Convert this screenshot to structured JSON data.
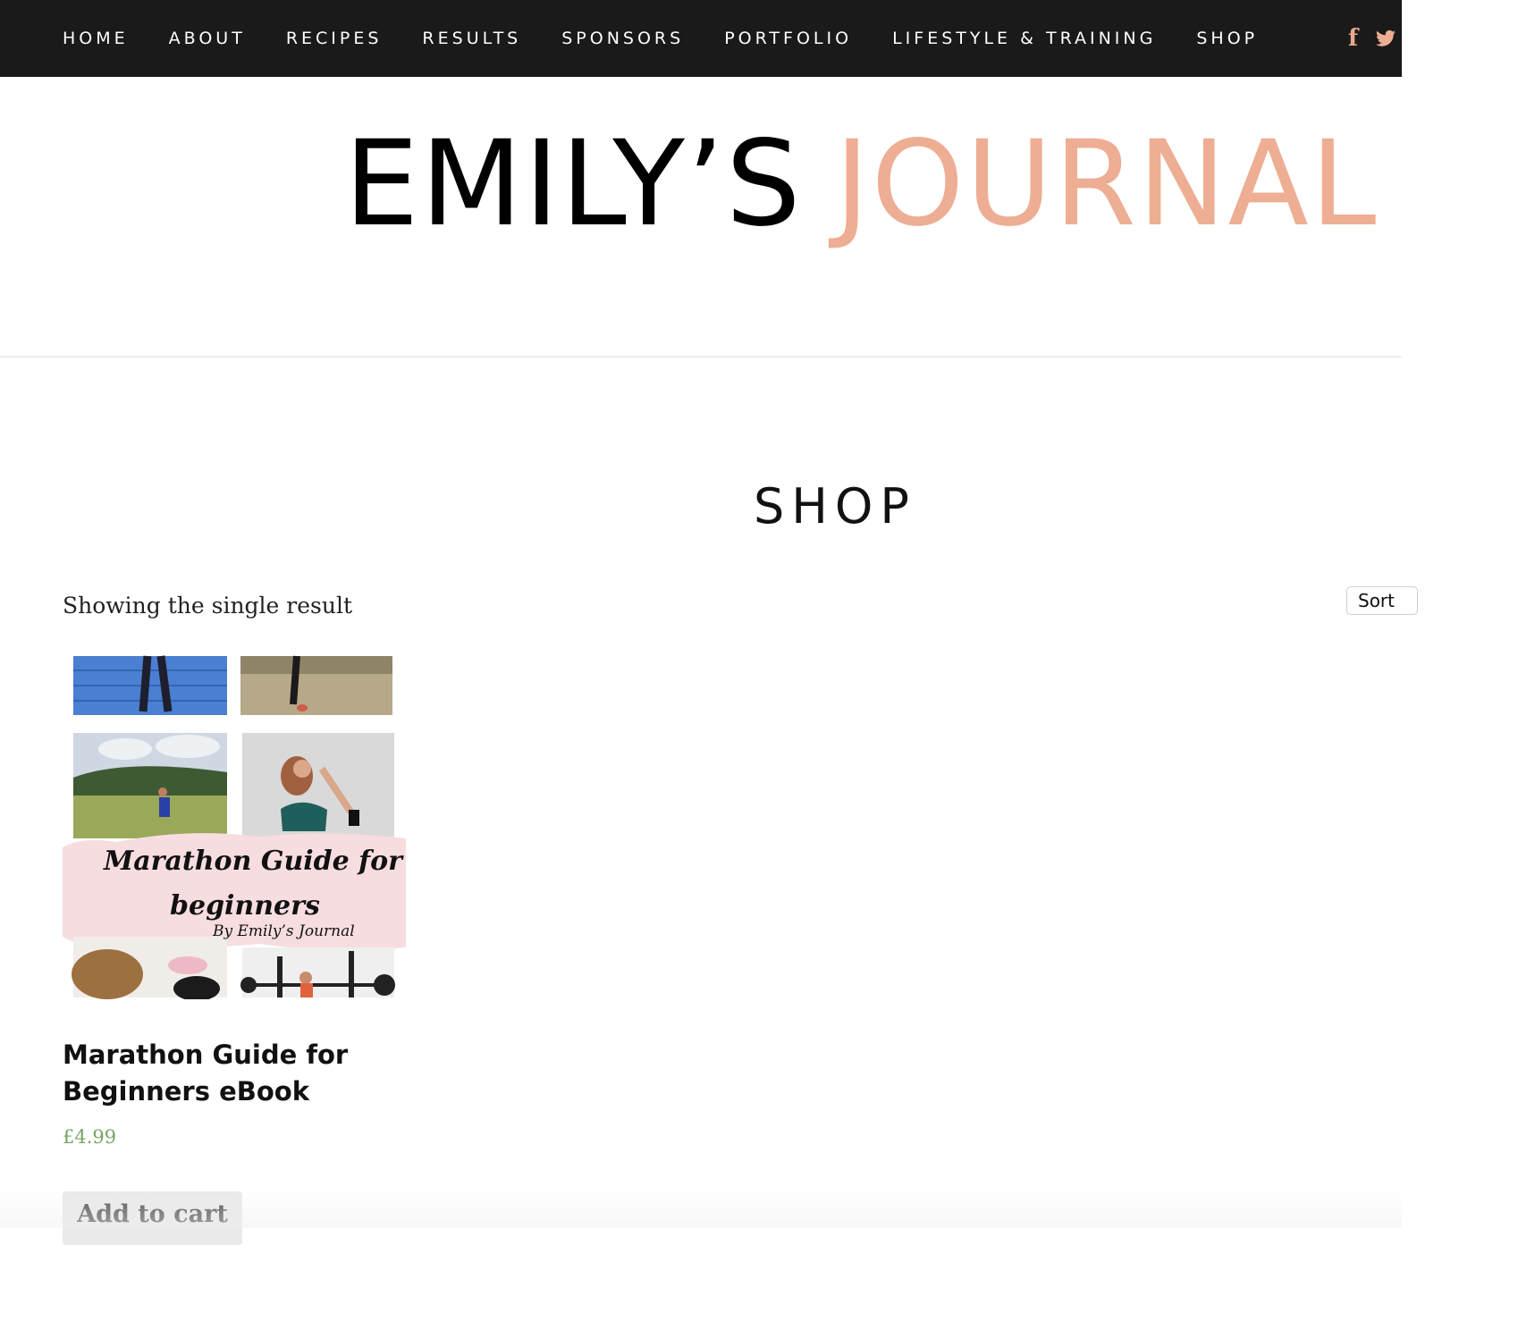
{
  "nav": {
    "items": [
      {
        "label": "HOME"
      },
      {
        "label": "ABOUT"
      },
      {
        "label": "RECIPES"
      },
      {
        "label": "RESULTS"
      },
      {
        "label": "SPONSORS"
      },
      {
        "label": "PORTFOLIO"
      },
      {
        "label": "LIFESTYLE & TRAINING"
      },
      {
        "label": "SHOP"
      }
    ],
    "social": {
      "facebook_glyph": "f",
      "facebook_icon": "facebook-icon",
      "twitter_icon": "twitter-icon"
    }
  },
  "logo": {
    "part1": "EMILY’S",
    "part2": "JOURNAL",
    "color_part1": "#000000",
    "color_part2": "#eeae93"
  },
  "page_title": "SHOP",
  "result_count": "Showing the single result",
  "sort": {
    "label": "Sort"
  },
  "product": {
    "image_text": {
      "line1": "Marathon Guide for",
      "line2": "beginners",
      "line3": "By Emily’s Journal"
    },
    "title": "Marathon Guide for Beginners eBook",
    "price": "£4.99",
    "add_to_cart": "Add to cart"
  },
  "colors": {
    "nav_bg": "#1a1a1a",
    "accent": "#eeae93",
    "price": "#77a464"
  }
}
